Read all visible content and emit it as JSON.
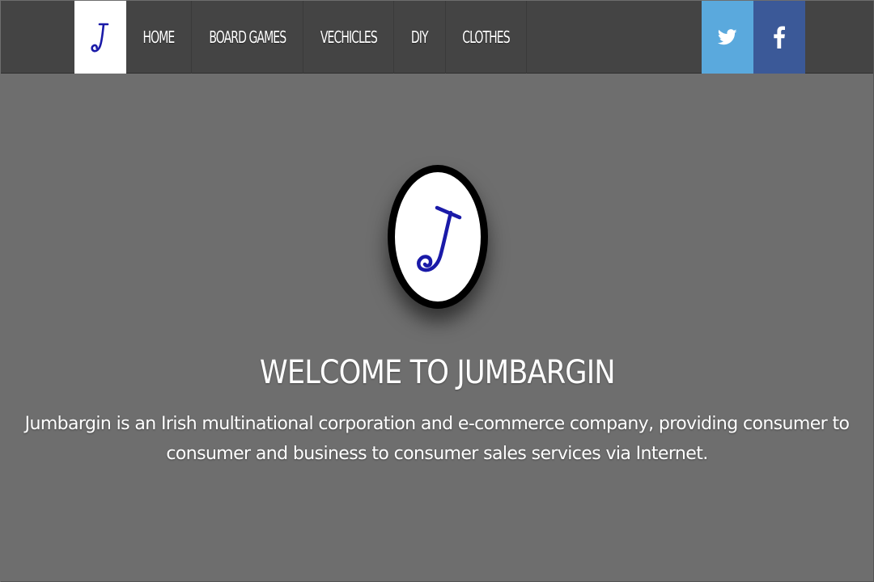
{
  "brand": {
    "logo_letter": "J",
    "logo_color": "#1a1aa8"
  },
  "nav": {
    "items": [
      {
        "label": "HOME"
      },
      {
        "label": "BOARD GAMES"
      },
      {
        "label": "VECHICLES"
      },
      {
        "label": "DIY"
      },
      {
        "label": "CLOTHES"
      }
    ]
  },
  "social": {
    "twitter_icon": "twitter-icon",
    "facebook_icon": "facebook-icon",
    "facebook_glyph": "f",
    "twitter_color": "#5aa9dd",
    "facebook_color": "#3b5998"
  },
  "hero": {
    "title": "WELCOME TO JUMBARGIN",
    "description": "Jumbargin is an Irish multinational corporation and e-commerce company, providing consumer to consumer and business to consumer sales services via Internet."
  },
  "colors": {
    "navbar_bg": "#444444",
    "page_bg": "#6e6e6e",
    "text": "#ffffff"
  }
}
